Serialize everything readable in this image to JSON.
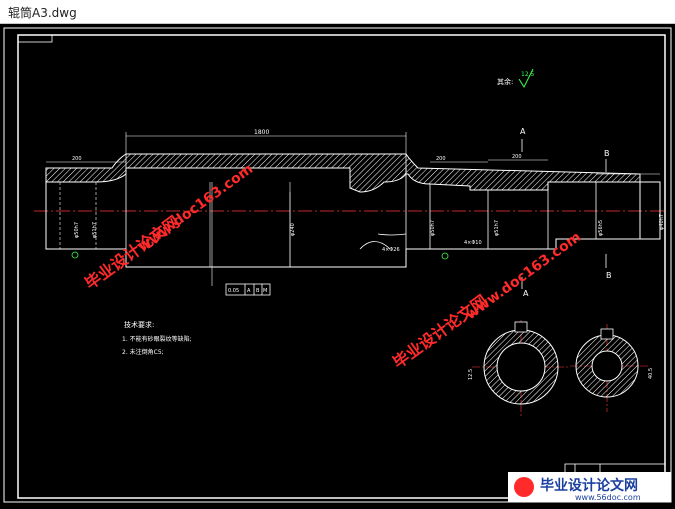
{
  "window": {
    "title": "辊筒A3.dwg"
  },
  "drawing": {
    "colors": {
      "background": "#000000",
      "lines": "#ffffff",
      "hatch": "#ffffff",
      "dims": "#ffffff",
      "centerline": "#ff3b3b",
      "dimension_green": "#37ff4a",
      "watermark": "#ff2a2a"
    },
    "roughness": {
      "label": "其余:",
      "value": "12.5"
    },
    "section_markers": {
      "A": "A",
      "B": "B"
    },
    "dims": {
      "overall_top": "1800",
      "left_length": "200",
      "right_len1": "200",
      "right_len2": "200",
      "dia_left": "φ50h7",
      "dia_left2": "φ51h7",
      "dia_center": "φ240",
      "dia_right": "φ50h7",
      "dia_right2": "φ51h7",
      "dia_right3": "φ56h5",
      "dia_end": "φ40h7",
      "chamfer1": "4×Φ26",
      "chamfer2": "4×Φ10",
      "runout": "0.05",
      "datum_a": "A",
      "datum_b": "B",
      "mod": "M"
    },
    "notes": {
      "title": "技术要求:",
      "items": [
        "1. 不能有砂眼裂纹等缺陷;",
        "2. 未注倒角C5;"
      ]
    },
    "section_dims": {
      "left": "12.5",
      "right": "40.5"
    },
    "watermarks": {
      "cn": "毕业设计论文网",
      "url": "www.doc163.com"
    },
    "logo": {
      "cn": "毕业设计论文网",
      "url": "www.56doc.com"
    }
  }
}
